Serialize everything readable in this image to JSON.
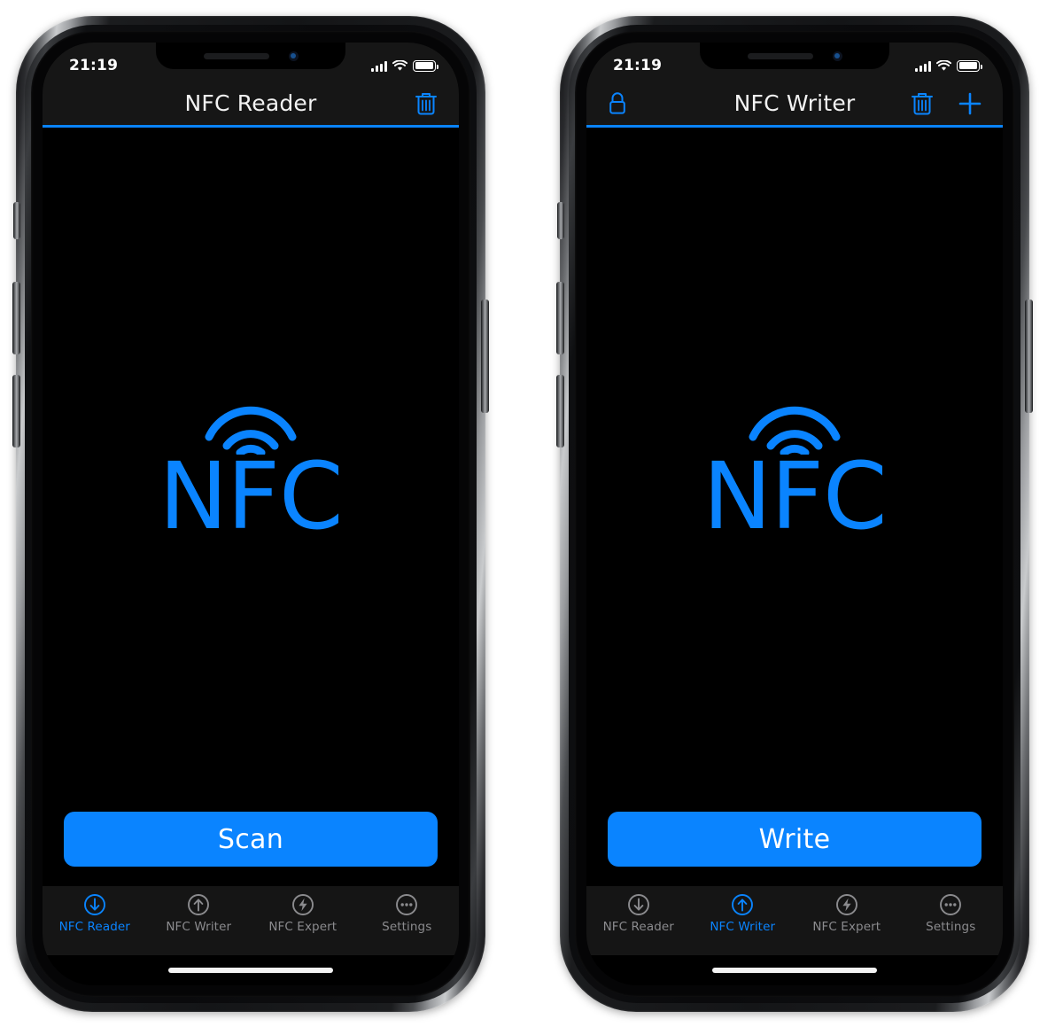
{
  "theme": {
    "accent": "#0a84ff",
    "screen_bg": "#000000",
    "bar_bg": "#161616",
    "tabbar_bg": "#151515",
    "title_color": "#f2f2f2",
    "inactive_tab_color": "#8b8b8e",
    "button_text_color": "#ffffff"
  },
  "phones": [
    {
      "id": "phone-left",
      "status_bar": {
        "time": "21:19",
        "icons": [
          "signal-bars-icon",
          "wifi-icon",
          "battery-icon"
        ],
        "battery_level": "100"
      },
      "nav_bar": {
        "title": "NFC Reader",
        "left_items": [],
        "right_items": [
          {
            "name": "trash-icon",
            "label": "Delete"
          }
        ]
      },
      "hero": {
        "logo_text": "NFC",
        "logo_icon": "nfc-wave-icon"
      },
      "action_button": {
        "label": "Scan"
      },
      "tab_bar": {
        "items": [
          {
            "label": "NFC Reader",
            "icon": "arrow-down-circle-icon",
            "active": true
          },
          {
            "label": "NFC Writer",
            "icon": "arrow-up-circle-icon",
            "active": false
          },
          {
            "label": "NFC Expert",
            "icon": "bolt-circle-icon",
            "active": false
          },
          {
            "label": "Settings",
            "icon": "ellipsis-circle-icon",
            "active": false
          }
        ]
      }
    },
    {
      "id": "phone-right",
      "status_bar": {
        "time": "21:19",
        "icons": [
          "signal-bars-icon",
          "wifi-icon",
          "battery-icon"
        ],
        "battery_level": "100"
      },
      "nav_bar": {
        "title": "NFC Writer",
        "left_items": [
          {
            "name": "lock-icon",
            "label": "Lock"
          }
        ],
        "right_items": [
          {
            "name": "trash-icon",
            "label": "Delete"
          },
          {
            "name": "plus-icon",
            "label": "Add"
          }
        ]
      },
      "hero": {
        "logo_text": "NFC",
        "logo_icon": "nfc-wave-icon"
      },
      "action_button": {
        "label": "Write"
      },
      "tab_bar": {
        "items": [
          {
            "label": "NFC Reader",
            "icon": "arrow-down-circle-icon",
            "active": false
          },
          {
            "label": "NFC Writer",
            "icon": "arrow-up-circle-icon",
            "active": true
          },
          {
            "label": "NFC Expert",
            "icon": "bolt-circle-icon",
            "active": false
          },
          {
            "label": "Settings",
            "icon": "ellipsis-circle-icon",
            "active": false
          }
        ]
      }
    }
  ]
}
